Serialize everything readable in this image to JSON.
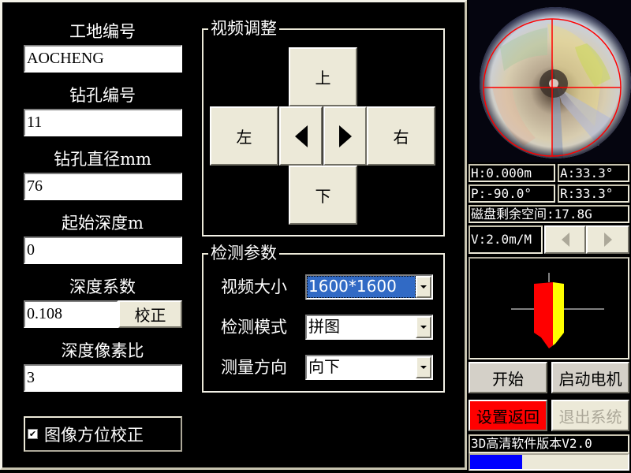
{
  "form": {
    "site_id": {
      "label": "工地编号",
      "value": "AOCHENG"
    },
    "hole_id": {
      "label": "钻孔编号",
      "value": "11"
    },
    "hole_diameter": {
      "label": "钻孔直径mm",
      "value": "76"
    },
    "start_depth": {
      "label": "起始深度m",
      "value": "0"
    },
    "depth_coefficient": {
      "label": "深度系数",
      "value": "0.108",
      "calibrate_label": "校正"
    },
    "depth_pixel_ratio": {
      "label": "深度像素比",
      "value": "3"
    },
    "orientation_correction": {
      "label": "图像方位校正",
      "checked": true
    }
  },
  "video_adjust": {
    "title": "视频调整",
    "up_label": "上",
    "down_label": "下",
    "left_label": "左",
    "right_label": "右",
    "rotate_left_icon": "triangle-left",
    "rotate_right_icon": "triangle-right"
  },
  "detect_params": {
    "title": "检测参数",
    "video_size": {
      "label": "视频大小",
      "value": "1600*1600"
    },
    "detect_mode": {
      "label": "检测模式",
      "value": "拼图"
    },
    "measure_direction": {
      "label": "测量方向",
      "value": "向下"
    }
  },
  "status": {
    "h": "H:0.000m",
    "a": "A:33.3°",
    "p": "P:-90.0°",
    "r": "R:33.3°",
    "disk": "磁盘剩余空间:17.8G",
    "speed": "V:2.0m/M"
  },
  "actions": {
    "start_label": "开始",
    "start_motor_label": "启动电机",
    "settings_back_label": "设置返回",
    "exit_label": "退出系统"
  },
  "footer": {
    "version": "3D高清软件版本V2.0",
    "progress_percent": 33
  },
  "colors": {
    "crosshair": "#ff0000",
    "probe_left": "#ff0000",
    "probe_right": "#ffff00",
    "progress": "#0000ff",
    "highlight_button": "#ff0000",
    "selection": "#316ac5"
  }
}
